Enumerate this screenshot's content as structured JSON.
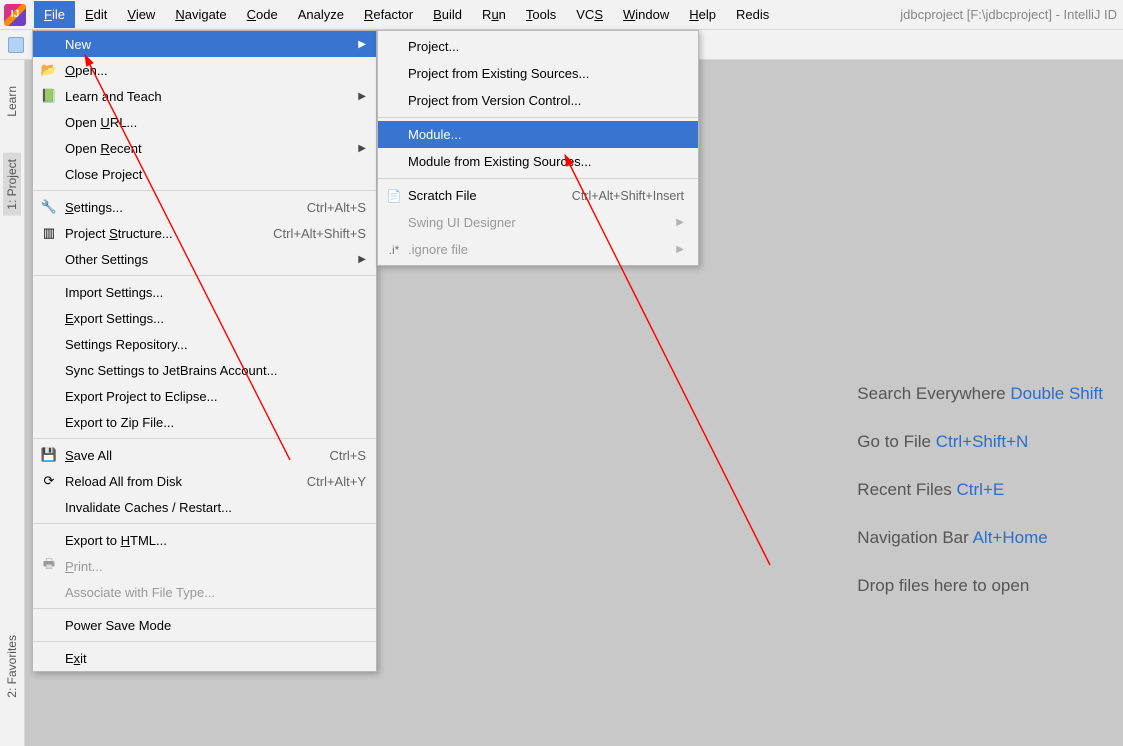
{
  "title": "jdbcproject [F:\\jdbcproject] - IntelliJ ID",
  "menubar": [
    {
      "label": "File",
      "u": 0,
      "active": true
    },
    {
      "label": "Edit",
      "u": 0
    },
    {
      "label": "View",
      "u": 0
    },
    {
      "label": "Navigate",
      "u": 0
    },
    {
      "label": "Code",
      "u": 0
    },
    {
      "label": "Analyze",
      "u": -1
    },
    {
      "label": "Refactor",
      "u": 0
    },
    {
      "label": "Build",
      "u": 0
    },
    {
      "label": "Run",
      "u": 1
    },
    {
      "label": "Tools",
      "u": 0
    },
    {
      "label": "VCS",
      "u": 2
    },
    {
      "label": "Window",
      "u": 0
    },
    {
      "label": "Help",
      "u": 0
    },
    {
      "label": "Redis",
      "u": -1
    }
  ],
  "file_menu": [
    {
      "label": "New",
      "highlight": true,
      "arrow": true
    },
    {
      "label": "Open...",
      "icon": "📂",
      "u": 0
    },
    {
      "label": "Learn and Teach",
      "icon": "📗",
      "arrow": true
    },
    {
      "label": "Open URL...",
      "u": 5
    },
    {
      "label": "Open Recent",
      "arrow": true,
      "u": 5
    },
    {
      "label": "Close Project"
    },
    {
      "sep": true
    },
    {
      "label": "Settings...",
      "icon": "🔧",
      "shortcut": "Ctrl+Alt+S",
      "u": 0
    },
    {
      "label": "Project Structure...",
      "icon": "▥",
      "shortcut": "Ctrl+Alt+Shift+S",
      "u": 8
    },
    {
      "label": "Other Settings",
      "arrow": true
    },
    {
      "sep": true
    },
    {
      "label": "Import Settings..."
    },
    {
      "label": "Export Settings...",
      "u": 0
    },
    {
      "label": "Settings Repository..."
    },
    {
      "label": "Sync Settings to JetBrains Account..."
    },
    {
      "label": "Export Project to Eclipse..."
    },
    {
      "label": "Export to Zip File..."
    },
    {
      "sep": true
    },
    {
      "label": "Save All",
      "icon": "💾",
      "shortcut": "Ctrl+S",
      "u": 0
    },
    {
      "label": "Reload All from Disk",
      "icon": "⟳",
      "shortcut": "Ctrl+Alt+Y"
    },
    {
      "label": "Invalidate Caches / Restart..."
    },
    {
      "sep": true
    },
    {
      "label": "Export to HTML...",
      "u": 10
    },
    {
      "label": "Print...",
      "icon": "🖶",
      "disabled": true,
      "u": 0
    },
    {
      "label": "Associate with File Type...",
      "disabled": true
    },
    {
      "sep": true
    },
    {
      "label": "Power Save Mode"
    },
    {
      "sep": true
    },
    {
      "label": "Exit",
      "u": 1
    }
  ],
  "new_submenu": [
    {
      "label": "Project..."
    },
    {
      "label": "Project from Existing Sources..."
    },
    {
      "label": "Project from Version Control..."
    },
    {
      "sep": true
    },
    {
      "label": "Module...",
      "highlight": true
    },
    {
      "label": "Module from Existing Sources..."
    },
    {
      "sep": true
    },
    {
      "label": "Scratch File",
      "icon": "📄",
      "shortcut": "Ctrl+Alt+Shift+Insert"
    },
    {
      "label": "Swing UI Designer",
      "disabled": true,
      "arrow": true
    },
    {
      "label": ".ignore file",
      "icon": ".i*",
      "disabled": true,
      "arrow": true
    }
  ],
  "sidebar": {
    "learn": "Learn",
    "project": "1: Project",
    "favorites": "2: Favorites"
  },
  "welcome": [
    {
      "text": "Search Everywhere ",
      "key": "Double Shift"
    },
    {
      "text": "Go to File ",
      "key": "Ctrl+Shift+N"
    },
    {
      "text": "Recent Files ",
      "key": "Ctrl+E"
    },
    {
      "text": "Navigation Bar ",
      "key": "Alt+Home"
    },
    {
      "text": "Drop files here to open",
      "key": ""
    }
  ]
}
